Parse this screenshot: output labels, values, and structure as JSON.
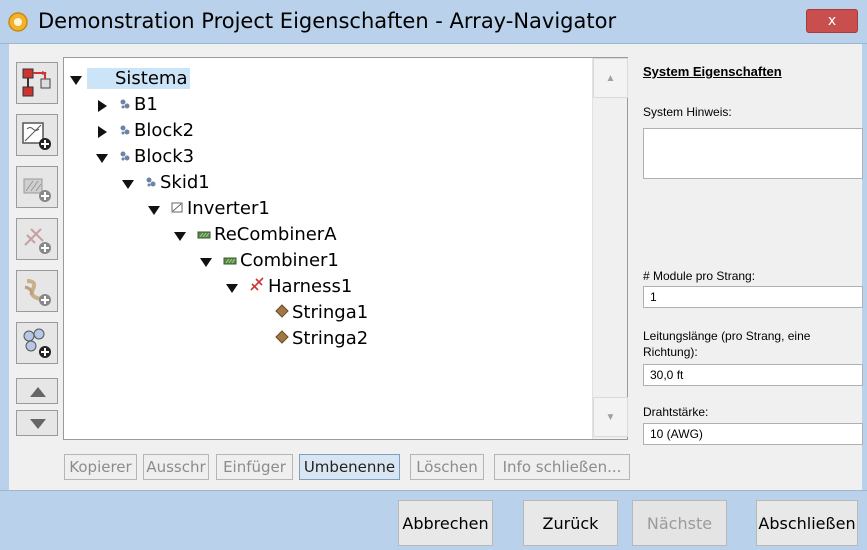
{
  "window": {
    "title": "Demonstration Project Eigenschaften - Array-Navigator",
    "close_label": "x"
  },
  "toolbar": {
    "buttons": [
      {
        "icon": "array-navigator-icon"
      },
      {
        "icon": "add-inverter-icon"
      },
      {
        "icon": "add-combiner-icon"
      },
      {
        "icon": "add-harness-icon"
      },
      {
        "icon": "add-string-icon"
      },
      {
        "icon": "add-module-group-icon"
      }
    ],
    "up_icon": "arrow-up-icon",
    "down_icon": "arrow-down-icon"
  },
  "tree": {
    "nodes": [
      {
        "label": "Sistema",
        "level": 0,
        "expanded": true,
        "has_children": true,
        "icon": "",
        "selected": true
      },
      {
        "label": "B1",
        "level": 1,
        "expanded": false,
        "has_children": true,
        "icon": "block-icon"
      },
      {
        "label": "Block2",
        "level": 1,
        "expanded": false,
        "has_children": true,
        "icon": "block-icon"
      },
      {
        "label": "Block3",
        "level": 1,
        "expanded": true,
        "has_children": true,
        "icon": "block-icon"
      },
      {
        "label": "Skid1",
        "level": 2,
        "expanded": true,
        "has_children": true,
        "icon": "block-icon"
      },
      {
        "label": "Inverter1",
        "level": 3,
        "expanded": true,
        "has_children": true,
        "icon": "inverter-icon"
      },
      {
        "label": "ReCombinerA",
        "level": 4,
        "expanded": true,
        "has_children": true,
        "icon": "combiner-icon"
      },
      {
        "label": "Combiner1",
        "level": 5,
        "expanded": true,
        "has_children": true,
        "icon": "combiner-icon"
      },
      {
        "label": "Harness1",
        "level": 6,
        "expanded": true,
        "has_children": true,
        "icon": "harness-icon"
      },
      {
        "label": "Stringa1",
        "level": 7,
        "expanded": false,
        "has_children": false,
        "icon": "string-icon"
      },
      {
        "label": "Stringa2",
        "level": 7,
        "expanded": false,
        "has_children": false,
        "icon": "string-icon"
      }
    ]
  },
  "actions": {
    "copy": "Kopierer",
    "cut": "Ausschr",
    "paste": "Einfüger",
    "rename": "Umbenenne",
    "delete": "Löschen",
    "close_info": "Info schließen..."
  },
  "properties": {
    "title": "System Eigenschaften",
    "note_label": "System Hinweis:",
    "note_value": "",
    "modules_label": "# Module pro Strang:",
    "modules_value": "1",
    "length_label_line1": "Leitungslänge (pro Strang, eine",
    "length_label_line2": "Richtung):",
    "length_value": "30,0 ft",
    "wire_label": "Drahtstärke:",
    "wire_value": "10 (AWG)"
  },
  "footer": {
    "cancel": "Abbrechen",
    "back": "Zurück",
    "next": "Nächste",
    "finish": "Abschließen"
  },
  "colors": {
    "frame": "#b9d1ea",
    "selection": "#cce4f7",
    "close": "#c94f4f"
  }
}
